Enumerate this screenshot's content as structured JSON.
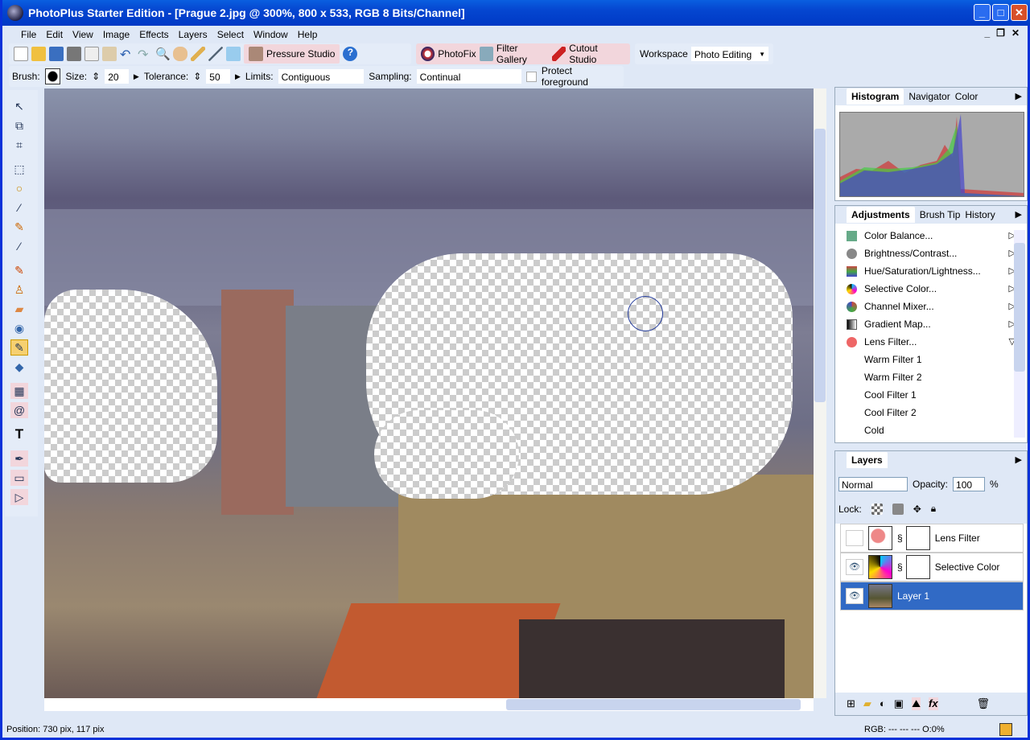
{
  "window": {
    "title": "PhotoPlus Starter Edition - [Prague 2.jpg @ 300%, 800 x 533, RGB 8 Bits/Channel]"
  },
  "menu": [
    "File",
    "Edit",
    "View",
    "Image",
    "Effects",
    "Layers",
    "Select",
    "Window",
    "Help"
  ],
  "toolbar": {
    "pressure_studio": "Pressure Studio",
    "photofix": "PhotoFix",
    "filter_gallery": "Filter Gallery",
    "cutout_studio": "Cutout Studio",
    "workspace_label": "Workspace",
    "workspace_value": "Photo Editing"
  },
  "context": {
    "brush_label": "Brush:",
    "size_label": "Size:",
    "size_value": "20",
    "tolerance_label": "Tolerance:",
    "tolerance_value": "50",
    "limits_label": "Limits:",
    "limits_value": "Contiguous",
    "sampling_label": "Sampling:",
    "sampling_value": "Continual",
    "protect_label": "Protect foreground",
    "protect_checked": false
  },
  "histogram_panel": {
    "tabs": [
      "Histogram",
      "Navigator",
      "Color"
    ],
    "active": "Histogram"
  },
  "adjustments_panel": {
    "tabs": [
      "Adjustments",
      "Brush Tip",
      "History"
    ],
    "active": "Adjustments",
    "items": [
      {
        "label": "Color Balance...",
        "icon": "color-balance-icon",
        "color": "#6a8"
      },
      {
        "label": "Brightness/Contrast...",
        "icon": "brightness-icon",
        "color": "#888"
      },
      {
        "label": "Hue/Saturation/Lightness...",
        "icon": "hue-icon",
        "color": "#c44"
      },
      {
        "label": "Selective Color...",
        "icon": "selective-color-icon",
        "color": "#333"
      },
      {
        "label": "Channel Mixer...",
        "icon": "channel-mixer-icon",
        "color": "#4a4"
      },
      {
        "label": "Gradient Map...",
        "icon": "gradient-map-icon",
        "color": "#555"
      },
      {
        "label": "Lens Filter...",
        "icon": "lens-filter-icon",
        "color": "#e66",
        "expanded": true
      }
    ],
    "subitems": [
      "Warm Filter 1",
      "Warm Filter 2",
      "Cool Filter 1",
      "Cool Filter 2",
      "Cold"
    ]
  },
  "layers_panel": {
    "title": "Layers",
    "blend_mode": "Normal",
    "opacity_label": "Opacity:",
    "opacity_value": "100",
    "opacity_unit": "%",
    "lock_label": "Lock:",
    "layers": [
      {
        "name": "Lens Filter",
        "visible": false,
        "selected": false
      },
      {
        "name": "Selective Color",
        "visible": true,
        "selected": false
      },
      {
        "name": "Layer 1",
        "visible": true,
        "selected": true
      }
    ]
  },
  "status": {
    "position": "Position: 730 pix, 117 pix",
    "rgb": "RGB: --- --- ---  O:0%"
  },
  "colors": {
    "selection": "#316ac5",
    "titlebar": "#0546d0"
  }
}
